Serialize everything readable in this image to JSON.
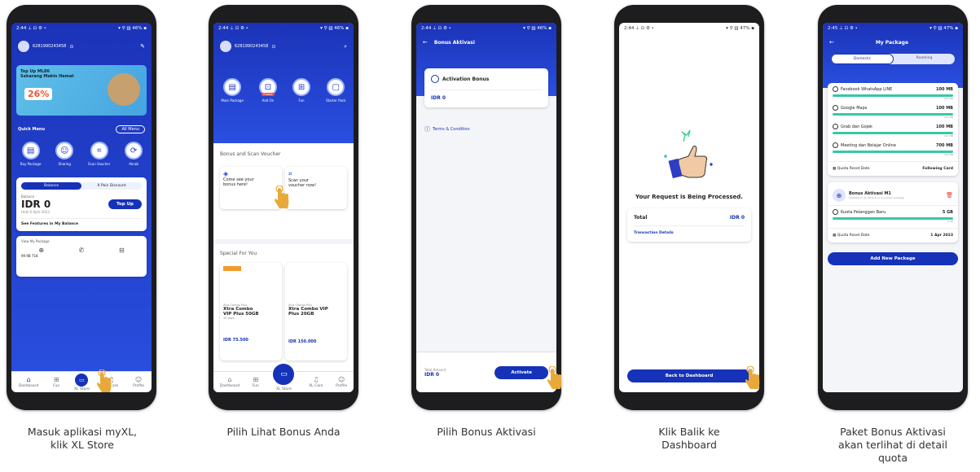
{
  "captions": [
    "Masuk aplikasi myXL,\nklik XL Store",
    "Pilih Lihat Bonus Anda",
    "Pilih Bonus Aktivasi",
    "Klik Balik ke\nDashboard",
    "Paket Bonus Aktivasi\nakan terlihat di detail\nquota"
  ],
  "p1": {
    "status_left": "2:44 ⊥ ⊡ ⚙ •",
    "status_right": "▾ ⚲ ▥ 46% ▪",
    "phone": "6281990243458",
    "banner_title": "Top Up ML86\nSekarang Makin Hemat",
    "banner_pct": "26%",
    "quick_menu": "Quick Menu",
    "all_menu": "All Menu",
    "menu": [
      "Buy Package",
      "Sharing",
      "Scan Voucher",
      "Akrab"
    ],
    "tab_balance": "Balance",
    "tab_point": "X Poin Discount",
    "balance_label": "Balance",
    "balance": "IDR 0",
    "valid": "Until 6 April 2023",
    "topup": "Top Up",
    "see": "See Features in My Balance",
    "pkg": "View My Package",
    "pkg_val": "99.9B 718",
    "nav": [
      "Dashboard",
      "Fun",
      "XL Store",
      "XL Care",
      "Profile"
    ]
  },
  "p2": {
    "status_left": "2:44 ⊥ ⊡ ⚙ •",
    "status_right": "▾ ⚲ ▥ 46% ▪",
    "phone": "6281990243458",
    "icons": [
      "Main Package",
      "Add On",
      "Fun",
      "Starter Pack"
    ],
    "promo": "Promo",
    "bonus_title": "Bonus and Scan Voucher",
    "bonus1": "Come see your\nbonus here!",
    "bonus2": "Scan your\nvoucher now!",
    "special": "Special For You",
    "offer1": "Xtra Combo\nVIP Plus 50GB",
    "offer2": "Xtra Combo VIP\nPlus 20GB",
    "offer_small": "Xtra Combo Plus",
    "offer_strike": "30 days",
    "price1": "IDR 75.500",
    "price2": "IDR 150.000",
    "nav": [
      "Dashboard",
      "Fun",
      "XL Store",
      "XL Care",
      "Profile"
    ]
  },
  "p3": {
    "status_left": "2:44 ⊥ ⊡ ⚙ •",
    "status_right": "▾ ⚲ ▥ 46% ▪",
    "title": "Bonus Aktivasi",
    "card_title": "Activation Bonus",
    "card_price": "IDR 0",
    "terms": "Terms & Condition",
    "total_label": "Total Amount",
    "total": "IDR 0",
    "activate": "Activate"
  },
  "p4": {
    "status_left": "2:44 ⊥ ⊡ ⚙ •",
    "status_right": "▾ ⚲ ▥ 47% ▪",
    "message": "Your Request is Being Processed.",
    "total": "Total",
    "total_val": "IDR 0",
    "details": "Transaction Details",
    "back": "Back to Dashboard"
  },
  "p5": {
    "status_left": "2:45 ⊥ ⊡ ⚙ •",
    "status_right": "▾ ⚲ ▥ 47% ▪",
    "title": "My Package",
    "tab1": "Domestic",
    "tab2": "Roaming",
    "rows": [
      {
        "name": "Facebook WhatsApp LINE",
        "val": "100 MB",
        "sub": "100 MB"
      },
      {
        "name": "Google Maps",
        "val": "100 MB",
        "sub": "100 MB"
      },
      {
        "name": "Grab dan Gojek",
        "val": "100 MB",
        "sub": "100 MB"
      },
      {
        "name": "Meeting dan Belajar Online",
        "val": "700 MB",
        "sub": "700 MB"
      }
    ],
    "reset1": "Quota Reset Date",
    "reset1_val": "Following Card",
    "bonus_name": "Bonus Aktivasi M1",
    "bonus_sub": "Available in XL Store & on a number package",
    "row_new": "Kuota Pelanggan Baru",
    "row_new_val": "5 GB",
    "row_new_sub": "5 GB",
    "reset2": "Quota Reset Date",
    "reset2_val": "1 Apr 2023",
    "add": "Add New Package"
  }
}
